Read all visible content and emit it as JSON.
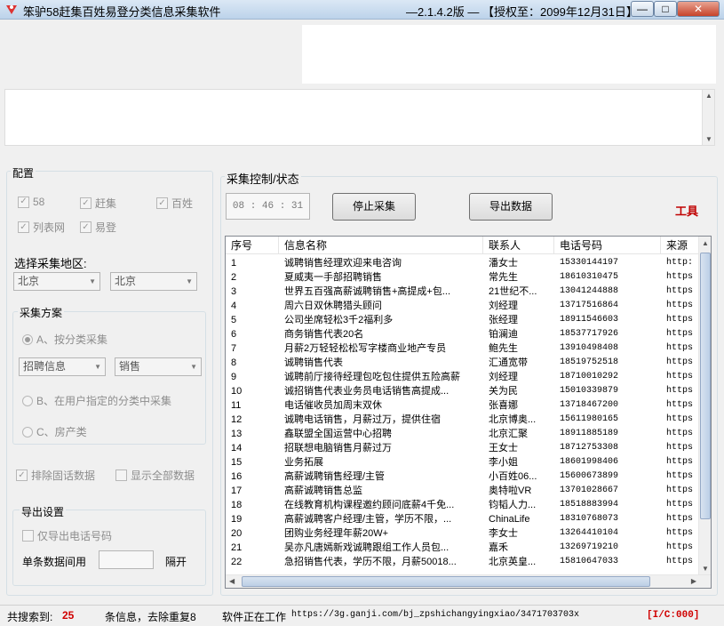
{
  "window": {
    "title": "笨驴58赶集百姓易登分类信息采集软件",
    "version": "—2.1.4.2版 — 【授权至：2099年12月31日】",
    "minimize": "—",
    "maximize": "□",
    "close": "✕"
  },
  "config": {
    "label": "配置",
    "sources": [
      {
        "label": "58",
        "checked": true
      },
      {
        "label": "赶集",
        "checked": true
      },
      {
        "label": "百姓",
        "checked": true
      },
      {
        "label": "列表网",
        "checked": true
      },
      {
        "label": "易登",
        "checked": true
      }
    ],
    "region_label": "选择采集地区:",
    "province": "北京",
    "city": "北京",
    "plan": {
      "label": "采集方案",
      "option_a": "A、按分类采集",
      "category": "招聘信息",
      "subcategory": "销售",
      "option_b": "B、在用户指定的分类中采集",
      "option_c": "C、房产类"
    },
    "exclude_fixed": "排除固话数据",
    "show_all": "显示全部数据",
    "export": {
      "label": "导出设置",
      "only_phone": "仅导出电话号码",
      "interval_label": "单条数据间用",
      "separator": "隔开",
      "interval_value": ""
    }
  },
  "control": {
    "label": "采集控制/状态",
    "timer": "08 : 46 : 31",
    "stop_button": "停止采集",
    "export_button": "导出数据",
    "tools": "工具"
  },
  "table": {
    "columns": [
      "序号",
      "信息名称",
      "联系人",
      "电话号码",
      "来源"
    ],
    "rows": [
      [
        "1",
        "诚聘销售经理欢迎来电咨询",
        "潘女士",
        "15330144197",
        "http:"
      ],
      [
        "2",
        "夏威夷一手部招聘销售",
        "常先生",
        "18610310475",
        "https"
      ],
      [
        "3",
        "世界五百强高薪诚聘销售+高提成+包...",
        "21世纪不...",
        "13041244888",
        "https"
      ],
      [
        "4",
        "周六日双休聘猎头顾问",
        "刘经理",
        "13717516864",
        "https"
      ],
      [
        "5",
        "公司坐席轻松3千2福利多",
        "张经理",
        "18911546603",
        "https"
      ],
      [
        "6",
        "商务销售代表20名",
        "铂澜迪",
        "18537717926",
        "https"
      ],
      [
        "7",
        "月薪2万轻轻松松写字楼商业地产专员",
        "鲍先生",
        "13910498408",
        "https"
      ],
      [
        "8",
        "诚聘销售代表",
        "汇通宽带",
        "18519752518",
        "https"
      ],
      [
        "9",
        "诚聘前厅接待经理包吃包住提供五险高薪",
        "刘经理",
        "18710010292",
        "https"
      ],
      [
        "10",
        "诚招销售代表业务员电话销售高提成...",
        "关为民",
        "15010339879",
        "https"
      ],
      [
        "11",
        "电话催收员加周末双休",
        "张喜娜",
        "13718467200",
        "https"
      ],
      [
        "12",
        "诚聘电话销售，月薪过万，提供住宿",
        "北京博奥...",
        "15611980165",
        "https"
      ],
      [
        "13",
        "鑫联盟全国运营中心招聘",
        "北京汇聚",
        "18911885189",
        "https"
      ],
      [
        "14",
        "招联想电脑销售月薪过万",
        "王女士",
        "18712753308",
        "https"
      ],
      [
        "15",
        "业务拓展",
        "李小姐",
        "18601998406",
        "https"
      ],
      [
        "16",
        "高薪诚聘销售经理/主管",
        "小百姓06...",
        "15600673899",
        "https"
      ],
      [
        "17",
        "高薪诚聘销售总监",
        "奥特啦VR",
        "13701028667",
        "https"
      ],
      [
        "18",
        "在线教育机构课程邀约顾问底薪4千免...",
        "钧韬人力...",
        "18518883994",
        "https"
      ],
      [
        "19",
        "高薪诚聘客户经理/主管，学历不限，...",
        "ChinaLife",
        "18310768073",
        "https"
      ],
      [
        "20",
        "团购业务经理年薪20W+",
        "李女士",
        "13264410104",
        "https"
      ],
      [
        "21",
        "吴亦凡唐嫣新戏诚聘跟组工作人员包...",
        "嘉禾",
        "13269719210",
        "https"
      ],
      [
        "22",
        "急招销售代表，学历不限，月薪50018...",
        "北京英皇...",
        "15810647033",
        "https"
      ]
    ]
  },
  "status": {
    "found_label": "共搜索到:",
    "found_count": "25",
    "dedup": "条信息，去除重复8",
    "working": "软件正在工作",
    "url": "https://3g.ganji.com/bj_zpshichangyingxiao/3471703703x",
    "counter": "[I/C:000]"
  },
  "colors": {
    "accent_red": "#d00000",
    "tools_red": "#c00000"
  }
}
